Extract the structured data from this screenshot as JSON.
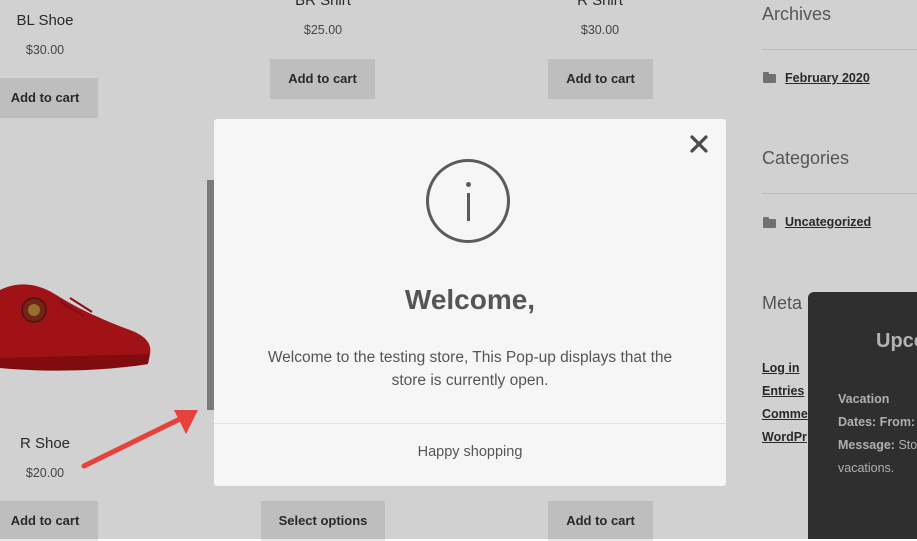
{
  "products": {
    "top_row": [
      {
        "name": "BL Shoe",
        "price": "$30.00",
        "button": "Add to cart"
      },
      {
        "name": "BR Shirt",
        "price": "$25.00",
        "button": "Add to cart"
      },
      {
        "name": "R Shirt",
        "price": "$30.00",
        "button": "Add to cart"
      }
    ],
    "bottom_row": [
      {
        "name": "R Shoe",
        "price": "$20.00",
        "button": "Add to cart"
      },
      {
        "button": "Select options"
      },
      {
        "button": "Add to cart"
      }
    ]
  },
  "sidebar": {
    "archives": {
      "title": "Archives",
      "link": "February 2020"
    },
    "categories": {
      "title": "Categories",
      "link": "Uncategorized"
    },
    "meta": {
      "title": "Meta",
      "links": [
        "Log in",
        "Entries",
        "Comme",
        "WordPr"
      ]
    }
  },
  "vacation_panel": {
    "title": "Upco",
    "label": "Vacation",
    "dates_label": "Dates: From:",
    "message_label": "Message:",
    "message_text": "Sto",
    "message_cont": "vacations."
  },
  "modal": {
    "icon": "info-icon",
    "title": "Welcome,",
    "message": "Welcome to the testing store, This Pop-up displays that the store is currently open.",
    "footer": "Happy shopping",
    "close_icon": "close-icon"
  },
  "colors": {
    "annotation_arrow": "#e8413c",
    "modal_bg": "#f6f6f6",
    "panel_bg": "#3a3a3a"
  }
}
